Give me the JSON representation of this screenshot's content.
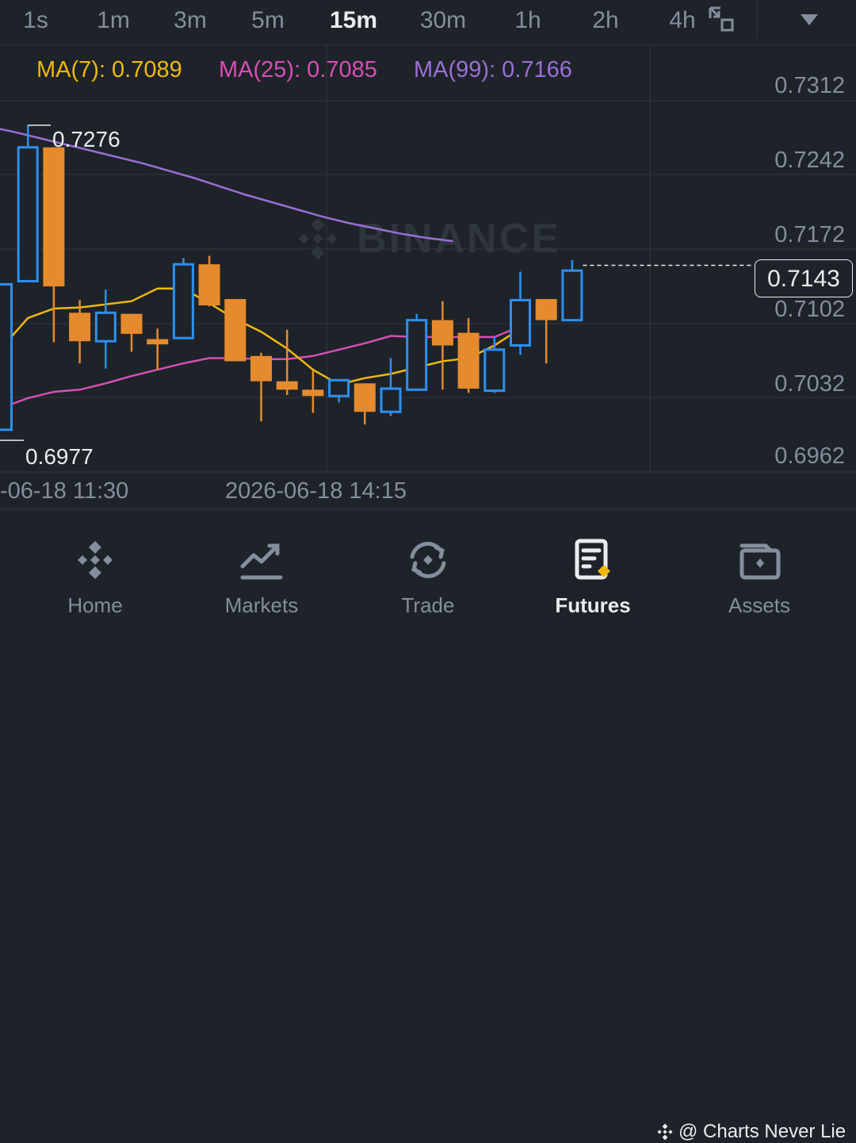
{
  "timeframes": [
    {
      "label": "1s"
    },
    {
      "label": "1m"
    },
    {
      "label": "3m"
    },
    {
      "label": "5m"
    },
    {
      "label": "15m",
      "active": true
    },
    {
      "label": "30m"
    },
    {
      "label": "1h"
    },
    {
      "label": "2h"
    },
    {
      "label": "4h"
    }
  ],
  "timeframe_icons": {
    "fullscreen": "fullscreen-exit-icon",
    "more": "chevron-down-icon"
  },
  "ma_legend": {
    "ma7": {
      "label": "MA(7): 0.7089",
      "color": "#f0b90b"
    },
    "ma25": {
      "label": "MA(25): 0.7085",
      "color": "#d64fb4"
    },
    "ma99": {
      "label": "MA(99): 0.7166",
      "color": "#9b6fd6"
    }
  },
  "price_axis": [
    "0.7312",
    "0.7242",
    "0.7172",
    "0.7102",
    "0.7032",
    "0.6962"
  ],
  "current_price": "0.7143",
  "high_label": "0.7276",
  "low_label": "0.6977",
  "time_axis": [
    "-06-18 11:30",
    "2026-06-18 14:15"
  ],
  "watermark": "BINANCE",
  "colors": {
    "up": "#2e8ff0",
    "down": "#e58b2e",
    "ma7": "#f0b90b",
    "ma25": "#d64fb4",
    "ma99": "#9b6fd6",
    "bg": "#1e2329",
    "grid": "#2b3139"
  },
  "chart_data": {
    "type": "candlestick",
    "y_range": [
      0.6962,
      0.7312
    ],
    "candles": [
      {
        "o": 0.6987,
        "h": 0.7125,
        "l": 0.6987,
        "c": 0.7125,
        "up": true
      },
      {
        "o": 0.7128,
        "h": 0.7276,
        "l": 0.7128,
        "c": 0.7255,
        "up": true
      },
      {
        "o": 0.7255,
        "h": 0.7255,
        "l": 0.707,
        "c": 0.7123,
        "up": false
      },
      {
        "o": 0.7098,
        "h": 0.711,
        "l": 0.705,
        "c": 0.7071,
        "up": false
      },
      {
        "o": 0.7071,
        "h": 0.712,
        "l": 0.7045,
        "c": 0.7098,
        "up": true
      },
      {
        "o": 0.7097,
        "h": 0.7097,
        "l": 0.7061,
        "c": 0.7078,
        "up": false
      },
      {
        "o": 0.7073,
        "h": 0.7083,
        "l": 0.7044,
        "c": 0.7068,
        "up": false
      },
      {
        "o": 0.7074,
        "h": 0.715,
        "l": 0.7074,
        "c": 0.7144,
        "up": true
      },
      {
        "o": 0.7144,
        "h": 0.7152,
        "l": 0.7104,
        "c": 0.7105,
        "up": false
      },
      {
        "o": 0.7111,
        "h": 0.7111,
        "l": 0.7052,
        "c": 0.7052,
        "up": false
      },
      {
        "o": 0.7057,
        "h": 0.706,
        "l": 0.6995,
        "c": 0.7033,
        "up": false
      },
      {
        "o": 0.7033,
        "h": 0.7082,
        "l": 0.702,
        "c": 0.7025,
        "up": false
      },
      {
        "o": 0.7025,
        "h": 0.7043,
        "l": 0.7003,
        "c": 0.7019,
        "up": false
      },
      {
        "o": 0.7019,
        "h": 0.7034,
        "l": 0.7013,
        "c": 0.7034,
        "up": true
      },
      {
        "o": 0.7031,
        "h": 0.7031,
        "l": 0.6992,
        "c": 0.7004,
        "up": false
      },
      {
        "o": 0.7004,
        "h": 0.7055,
        "l": 0.7,
        "c": 0.7026,
        "up": true
      },
      {
        "o": 0.7025,
        "h": 0.7097,
        "l": 0.7025,
        "c": 0.7091,
        "up": true
      },
      {
        "o": 0.7091,
        "h": 0.7109,
        "l": 0.7025,
        "c": 0.7067,
        "up": false
      },
      {
        "o": 0.7079,
        "h": 0.7093,
        "l": 0.7022,
        "c": 0.7026,
        "up": false
      },
      {
        "o": 0.7024,
        "h": 0.7075,
        "l": 0.7022,
        "c": 0.7063,
        "up": true
      },
      {
        "o": 0.7067,
        "h": 0.7137,
        "l": 0.7058,
        "c": 0.711,
        "up": true
      },
      {
        "o": 0.7111,
        "h": 0.7111,
        "l": 0.705,
        "c": 0.7091,
        "up": false
      },
      {
        "o": 0.7091,
        "h": 0.7148,
        "l": 0.7091,
        "c": 0.7138,
        "up": true
      }
    ],
    "ma99": [
      0.7275,
      0.727,
      0.7264,
      0.7258,
      0.7252,
      0.7246,
      0.724,
      0.7233,
      0.7226,
      0.7218,
      0.721,
      0.7203,
      0.7196,
      0.7189,
      0.7183,
      0.7178,
      0.7173,
      0.7169,
      0.7166
    ],
    "ma7": [
      0.7065,
      0.7093,
      0.7102,
      0.7103,
      0.7106,
      0.7109,
      0.7121,
      0.7121,
      0.7107,
      0.7092,
      0.708,
      0.7064,
      0.7044,
      0.703,
      0.7036,
      0.704,
      0.7046,
      0.7052,
      0.7055,
      0.7067,
      0.7083
    ],
    "ma25": [
      0.7008,
      0.7017,
      0.7023,
      0.7025,
      0.7031,
      0.7038,
      0.7044,
      0.705,
      0.7055,
      0.7055,
      0.7054,
      0.7054,
      0.7057,
      0.7063,
      0.7069,
      0.7076,
      0.7075,
      0.7075,
      0.7075,
      0.7075,
      0.7085
    ],
    "xlabel": "",
    "ylabel": ""
  },
  "nav": [
    {
      "label": "Home",
      "icon": "binance-logo-icon"
    },
    {
      "label": "Markets",
      "icon": "chart-line-icon"
    },
    {
      "label": "Trade",
      "icon": "trade-swap-icon"
    },
    {
      "label": "Futures",
      "icon": "futures-doc-icon",
      "active": true
    },
    {
      "label": "Assets",
      "icon": "wallet-icon"
    }
  ],
  "credit": "@ Charts Never Lie"
}
